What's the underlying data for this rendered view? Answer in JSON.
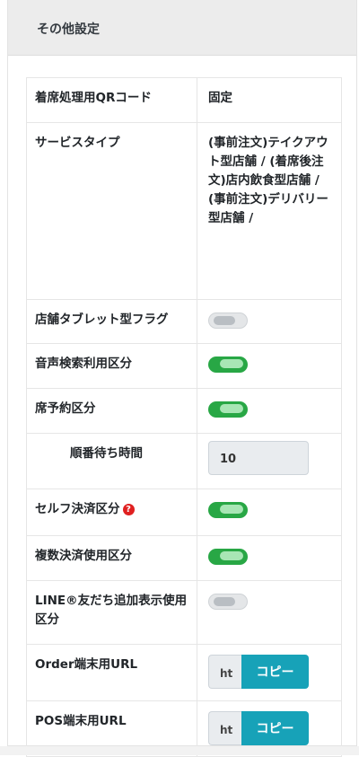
{
  "section": {
    "title": "その他設定"
  },
  "rows": {
    "qr": {
      "label": "着席処理用QRコード",
      "value": "固定"
    },
    "service": {
      "label": "サービスタイプ",
      "value": "(事前注文)テイクアウト型店舗 / (着席後注文)店内飲食型店舗 / (事前注文)デリバリー型店舗 /"
    },
    "tablet": {
      "label": "店舗タブレット型フラグ",
      "state": "off"
    },
    "voice": {
      "label": "音声検索利用区分",
      "state": "on"
    },
    "reserve": {
      "label": "席予約区分",
      "state": "on"
    },
    "wait": {
      "label": "順番待ち時間",
      "value": "10"
    },
    "self_pay": {
      "label": "セルフ決済区分",
      "state": "on"
    },
    "multi_pay": {
      "label": "複数決済使用区分",
      "state": "on"
    },
    "line": {
      "label": "LINE®友だち追加表示使用区分",
      "state": "off"
    },
    "order_url": {
      "label": "Order端末用URL",
      "value": "ht",
      "button": "コピー"
    },
    "pos_url": {
      "label": "POS端末用URL",
      "value": "ht",
      "button": "コピー"
    }
  },
  "colors": {
    "toggle_on": "#28a745",
    "copy_button": "#17a2b8",
    "help_icon": "#e02020"
  },
  "icons": {
    "help": "question-circle-icon"
  }
}
